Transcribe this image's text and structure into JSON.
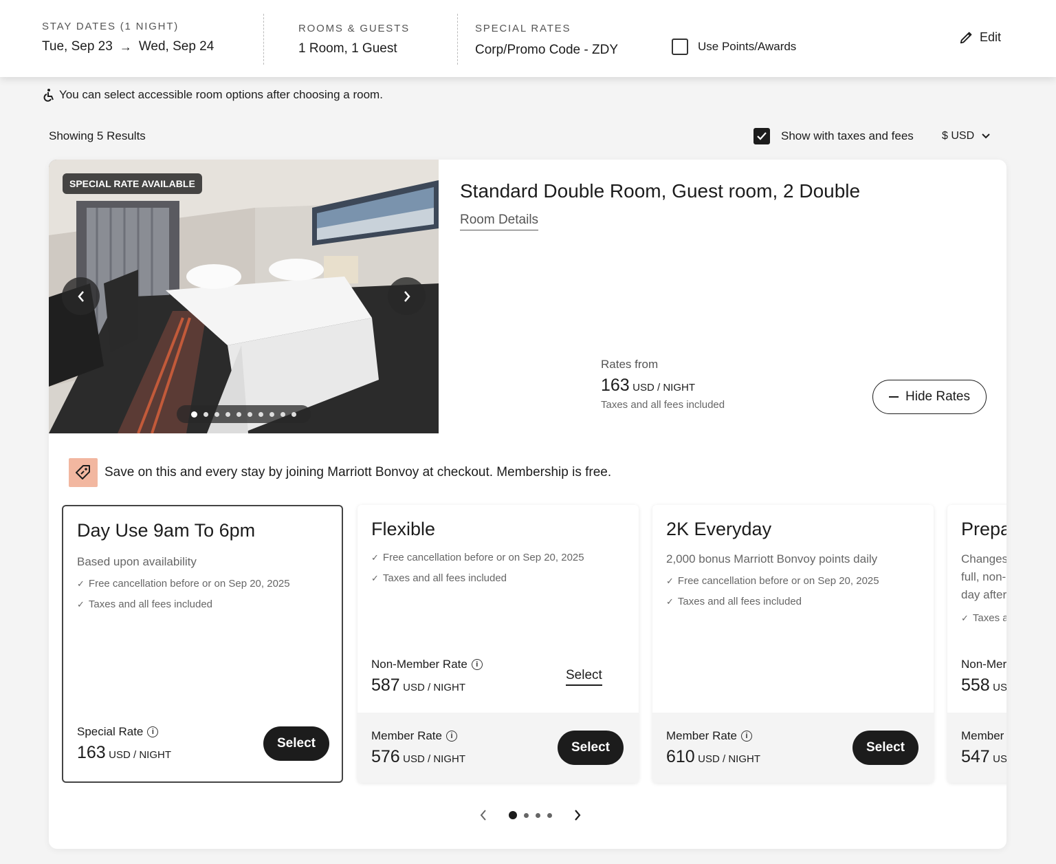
{
  "header": {
    "stay": {
      "label": "STAY DATES (1 NIGHT)",
      "checkin": "Tue, Sep 23",
      "checkout": "Wed, Sep 24"
    },
    "rooms": {
      "label": "ROOMS & GUESTS",
      "value": "1 Room, 1 Guest"
    },
    "special": {
      "label": "SPECIAL RATES",
      "value": "Corp/Promo Code - ZDY"
    },
    "points_label": "Use Points/Awards",
    "edit_label": "Edit"
  },
  "accessibility_note": "You can select accessible room options after choosing a room.",
  "results_label": "Showing 5 Results",
  "taxes_toggle_label": "Show with taxes and fees",
  "currency_label": "$ USD",
  "room": {
    "badge": "SPECIAL RATE AVAILABLE",
    "title": "Standard Double Room, Guest room, 2 Double",
    "details_link": "Room Details",
    "rates_from_label": "Rates from",
    "rates_from_price": "163",
    "unit": "USD / NIGHT",
    "taxes_note": "Taxes and all fees included",
    "hide_rates_label": "Hide Rates",
    "image_count": 10,
    "image_active_index": 1
  },
  "promo_text": "Save on this and every stay by joining Marriott Bonvoy at checkout. Membership is free.",
  "rates": [
    {
      "title": "Day Use 9am To 6pm",
      "subtitle": "Based upon availability",
      "features": [
        "Free cancellation before or on Sep 20, 2025",
        "Taxes and all fees included"
      ],
      "primary": {
        "label": "Special Rate",
        "price": "163",
        "unit": "USD / NIGHT",
        "button": "Select"
      }
    },
    {
      "title": "Flexible",
      "features": [
        "Free cancellation before or on Sep 20, 2025",
        "Taxes and all fees included"
      ],
      "secondary": {
        "label": "Non-Member Rate",
        "price": "587",
        "unit": "USD / NIGHT",
        "link": "Select"
      },
      "primary": {
        "label": "Member Rate",
        "price": "576",
        "unit": "USD / NIGHT",
        "button": "Select"
      }
    },
    {
      "title": "2K Everyday",
      "subtitle": "2,000 bonus Marriott Bonvoy points daily",
      "features": [
        "Free cancellation before or on Sep 20, 2025",
        "Taxes and all fees included"
      ],
      "primary": {
        "label": "Member Rate",
        "price": "610",
        "unit": "USD / NIGHT",
        "button": "Select"
      }
    },
    {
      "title": "Prepa",
      "subtitle_lines": [
        "Changes",
        "full, non-",
        "day after"
      ],
      "features": [
        "Taxes a"
      ],
      "secondary": {
        "label": "Non-Mer",
        "price": "558",
        "unit": "US"
      },
      "primary": {
        "label": "Member",
        "price": "547",
        "unit": "US"
      }
    }
  ],
  "pager": {
    "pages": 4,
    "active": 1
  }
}
